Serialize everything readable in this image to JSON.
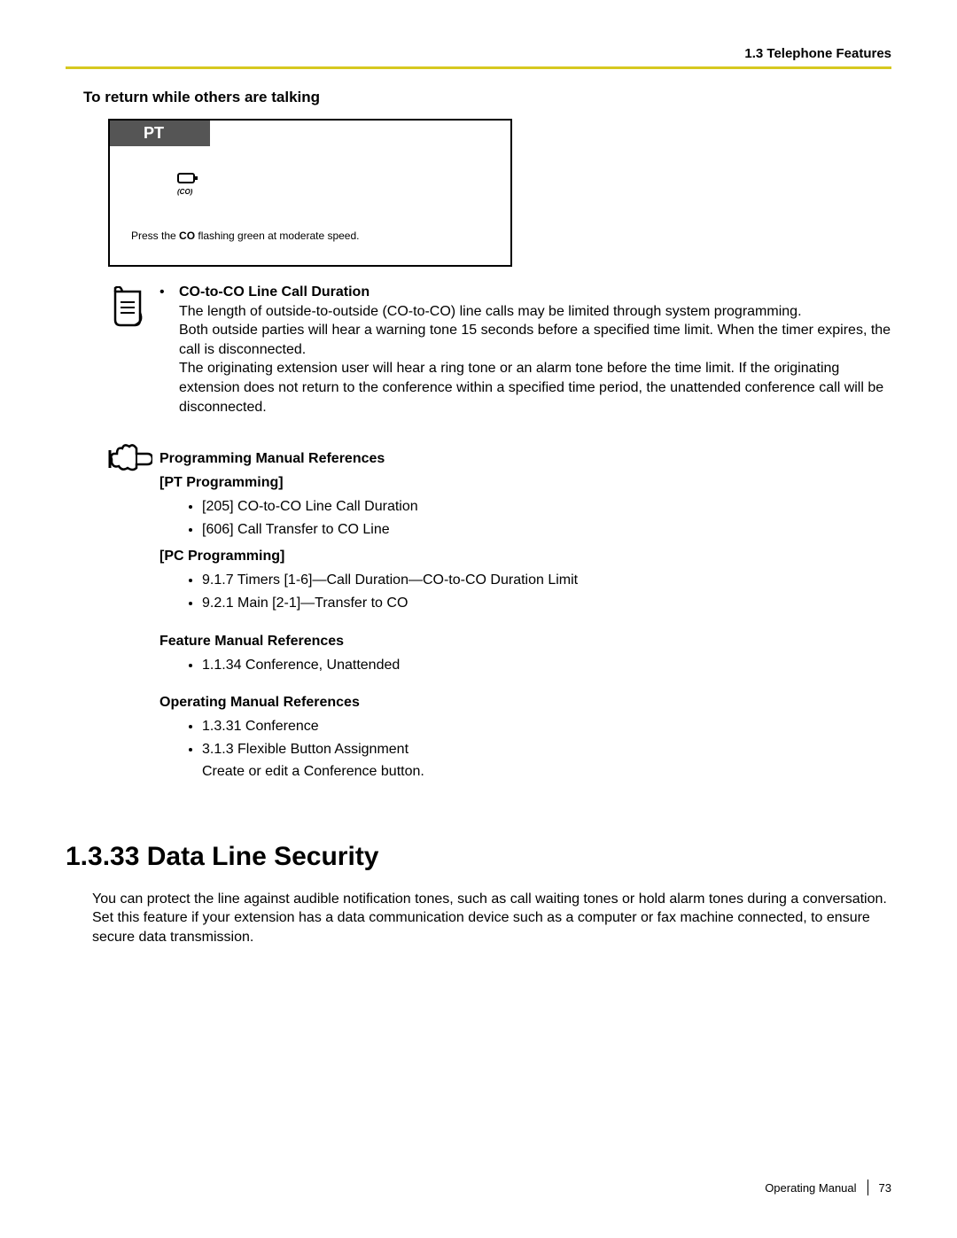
{
  "header": {
    "breadcrumb": "1.3 Telephone Features"
  },
  "subhead": "To return while others are talking",
  "pt_box": {
    "tab": "PT",
    "co_label": "(CO)",
    "caption_prefix": "Press the ",
    "caption_bold": "CO",
    "caption_suffix": " flashing green at moderate speed."
  },
  "note": {
    "bullet_title": "CO-to-CO Line Call Duration",
    "line1": "The length of outside-to-outside (CO-to-CO) line calls may be limited through system programming.",
    "line2": "Both outside parties will hear a warning tone 15 seconds before a specified time limit. When the timer expires, the call is disconnected.",
    "line3": "The originating extension user will hear a ring tone or an alarm tone before the time limit. If the originating extension does not return to the conference within a specified time period, the unattended conference call will be disconnected."
  },
  "refs": {
    "prog_heading": "Programming Manual References",
    "pt_heading": "[PT Programming]",
    "pt_items": [
      "[205] CO-to-CO Line Call Duration",
      "[606] Call Transfer to CO Line"
    ],
    "pc_heading": "[PC Programming]",
    "pc_items": [
      "9.1.7 Timers [1-6]—Call Duration—CO-to-CO Duration Limit",
      "9.2.1 Main [2-1]—Transfer to CO"
    ],
    "feature_heading": "Feature Manual References",
    "feature_items": [
      "1.1.34 Conference, Unattended"
    ],
    "op_heading": "Operating Manual References",
    "op_items": [
      "1.3.31 Conference",
      "3.1.3 Flexible Button Assignment"
    ],
    "op_tail": "Create or edit a Conference button."
  },
  "section": {
    "heading": "1.3.33  Data Line Security",
    "body": "You can protect the line against audible notification tones, such as call waiting tones or hold alarm tones during a conversation. Set this feature if your extension has a data communication device such as a computer or fax machine connected, to ensure secure data transmission."
  },
  "footer": {
    "manual": "Operating Manual",
    "page": "73"
  }
}
